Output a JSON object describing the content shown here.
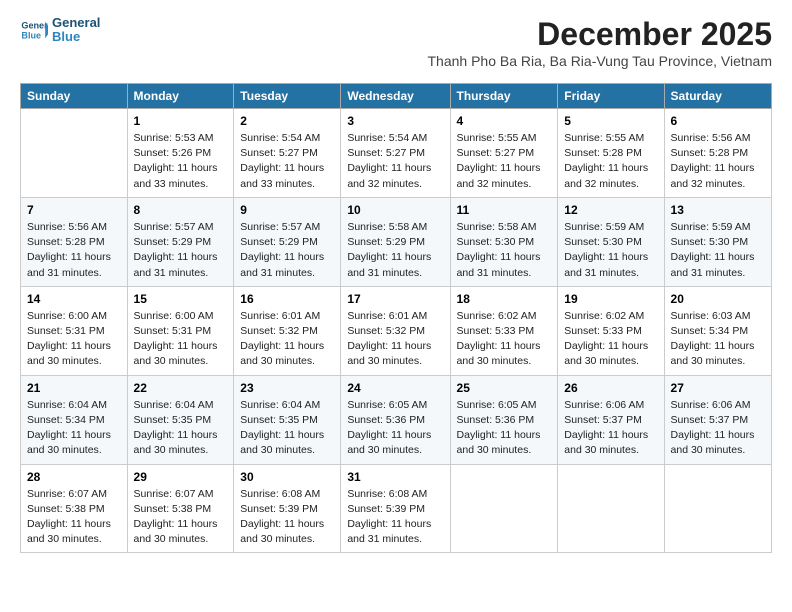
{
  "header": {
    "logo_line1": "General",
    "logo_line2": "Blue",
    "title": "December 2025",
    "subtitle": "Thanh Pho Ba Ria, Ba Ria-Vung Tau Province, Vietnam"
  },
  "days_of_week": [
    "Sunday",
    "Monday",
    "Tuesday",
    "Wednesday",
    "Thursday",
    "Friday",
    "Saturday"
  ],
  "weeks": [
    [
      {
        "day": "",
        "info": ""
      },
      {
        "day": "1",
        "info": "Sunrise: 5:53 AM\nSunset: 5:26 PM\nDaylight: 11 hours\nand 33 minutes."
      },
      {
        "day": "2",
        "info": "Sunrise: 5:54 AM\nSunset: 5:27 PM\nDaylight: 11 hours\nand 33 minutes."
      },
      {
        "day": "3",
        "info": "Sunrise: 5:54 AM\nSunset: 5:27 PM\nDaylight: 11 hours\nand 32 minutes."
      },
      {
        "day": "4",
        "info": "Sunrise: 5:55 AM\nSunset: 5:27 PM\nDaylight: 11 hours\nand 32 minutes."
      },
      {
        "day": "5",
        "info": "Sunrise: 5:55 AM\nSunset: 5:28 PM\nDaylight: 11 hours\nand 32 minutes."
      },
      {
        "day": "6",
        "info": "Sunrise: 5:56 AM\nSunset: 5:28 PM\nDaylight: 11 hours\nand 32 minutes."
      }
    ],
    [
      {
        "day": "7",
        "info": "Sunrise: 5:56 AM\nSunset: 5:28 PM\nDaylight: 11 hours\nand 31 minutes."
      },
      {
        "day": "8",
        "info": "Sunrise: 5:57 AM\nSunset: 5:29 PM\nDaylight: 11 hours\nand 31 minutes."
      },
      {
        "day": "9",
        "info": "Sunrise: 5:57 AM\nSunset: 5:29 PM\nDaylight: 11 hours\nand 31 minutes."
      },
      {
        "day": "10",
        "info": "Sunrise: 5:58 AM\nSunset: 5:29 PM\nDaylight: 11 hours\nand 31 minutes."
      },
      {
        "day": "11",
        "info": "Sunrise: 5:58 AM\nSunset: 5:30 PM\nDaylight: 11 hours\nand 31 minutes."
      },
      {
        "day": "12",
        "info": "Sunrise: 5:59 AM\nSunset: 5:30 PM\nDaylight: 11 hours\nand 31 minutes."
      },
      {
        "day": "13",
        "info": "Sunrise: 5:59 AM\nSunset: 5:30 PM\nDaylight: 11 hours\nand 31 minutes."
      }
    ],
    [
      {
        "day": "14",
        "info": "Sunrise: 6:00 AM\nSunset: 5:31 PM\nDaylight: 11 hours\nand 30 minutes."
      },
      {
        "day": "15",
        "info": "Sunrise: 6:00 AM\nSunset: 5:31 PM\nDaylight: 11 hours\nand 30 minutes."
      },
      {
        "day": "16",
        "info": "Sunrise: 6:01 AM\nSunset: 5:32 PM\nDaylight: 11 hours\nand 30 minutes."
      },
      {
        "day": "17",
        "info": "Sunrise: 6:01 AM\nSunset: 5:32 PM\nDaylight: 11 hours\nand 30 minutes."
      },
      {
        "day": "18",
        "info": "Sunrise: 6:02 AM\nSunset: 5:33 PM\nDaylight: 11 hours\nand 30 minutes."
      },
      {
        "day": "19",
        "info": "Sunrise: 6:02 AM\nSunset: 5:33 PM\nDaylight: 11 hours\nand 30 minutes."
      },
      {
        "day": "20",
        "info": "Sunrise: 6:03 AM\nSunset: 5:34 PM\nDaylight: 11 hours\nand 30 minutes."
      }
    ],
    [
      {
        "day": "21",
        "info": "Sunrise: 6:04 AM\nSunset: 5:34 PM\nDaylight: 11 hours\nand 30 minutes."
      },
      {
        "day": "22",
        "info": "Sunrise: 6:04 AM\nSunset: 5:35 PM\nDaylight: 11 hours\nand 30 minutes."
      },
      {
        "day": "23",
        "info": "Sunrise: 6:04 AM\nSunset: 5:35 PM\nDaylight: 11 hours\nand 30 minutes."
      },
      {
        "day": "24",
        "info": "Sunrise: 6:05 AM\nSunset: 5:36 PM\nDaylight: 11 hours\nand 30 minutes."
      },
      {
        "day": "25",
        "info": "Sunrise: 6:05 AM\nSunset: 5:36 PM\nDaylight: 11 hours\nand 30 minutes."
      },
      {
        "day": "26",
        "info": "Sunrise: 6:06 AM\nSunset: 5:37 PM\nDaylight: 11 hours\nand 30 minutes."
      },
      {
        "day": "27",
        "info": "Sunrise: 6:06 AM\nSunset: 5:37 PM\nDaylight: 11 hours\nand 30 minutes."
      }
    ],
    [
      {
        "day": "28",
        "info": "Sunrise: 6:07 AM\nSunset: 5:38 PM\nDaylight: 11 hours\nand 30 minutes."
      },
      {
        "day": "29",
        "info": "Sunrise: 6:07 AM\nSunset: 5:38 PM\nDaylight: 11 hours\nand 30 minutes."
      },
      {
        "day": "30",
        "info": "Sunrise: 6:08 AM\nSunset: 5:39 PM\nDaylight: 11 hours\nand 30 minutes."
      },
      {
        "day": "31",
        "info": "Sunrise: 6:08 AM\nSunset: 5:39 PM\nDaylight: 11 hours\nand 31 minutes."
      },
      {
        "day": "",
        "info": ""
      },
      {
        "day": "",
        "info": ""
      },
      {
        "day": "",
        "info": ""
      }
    ]
  ]
}
